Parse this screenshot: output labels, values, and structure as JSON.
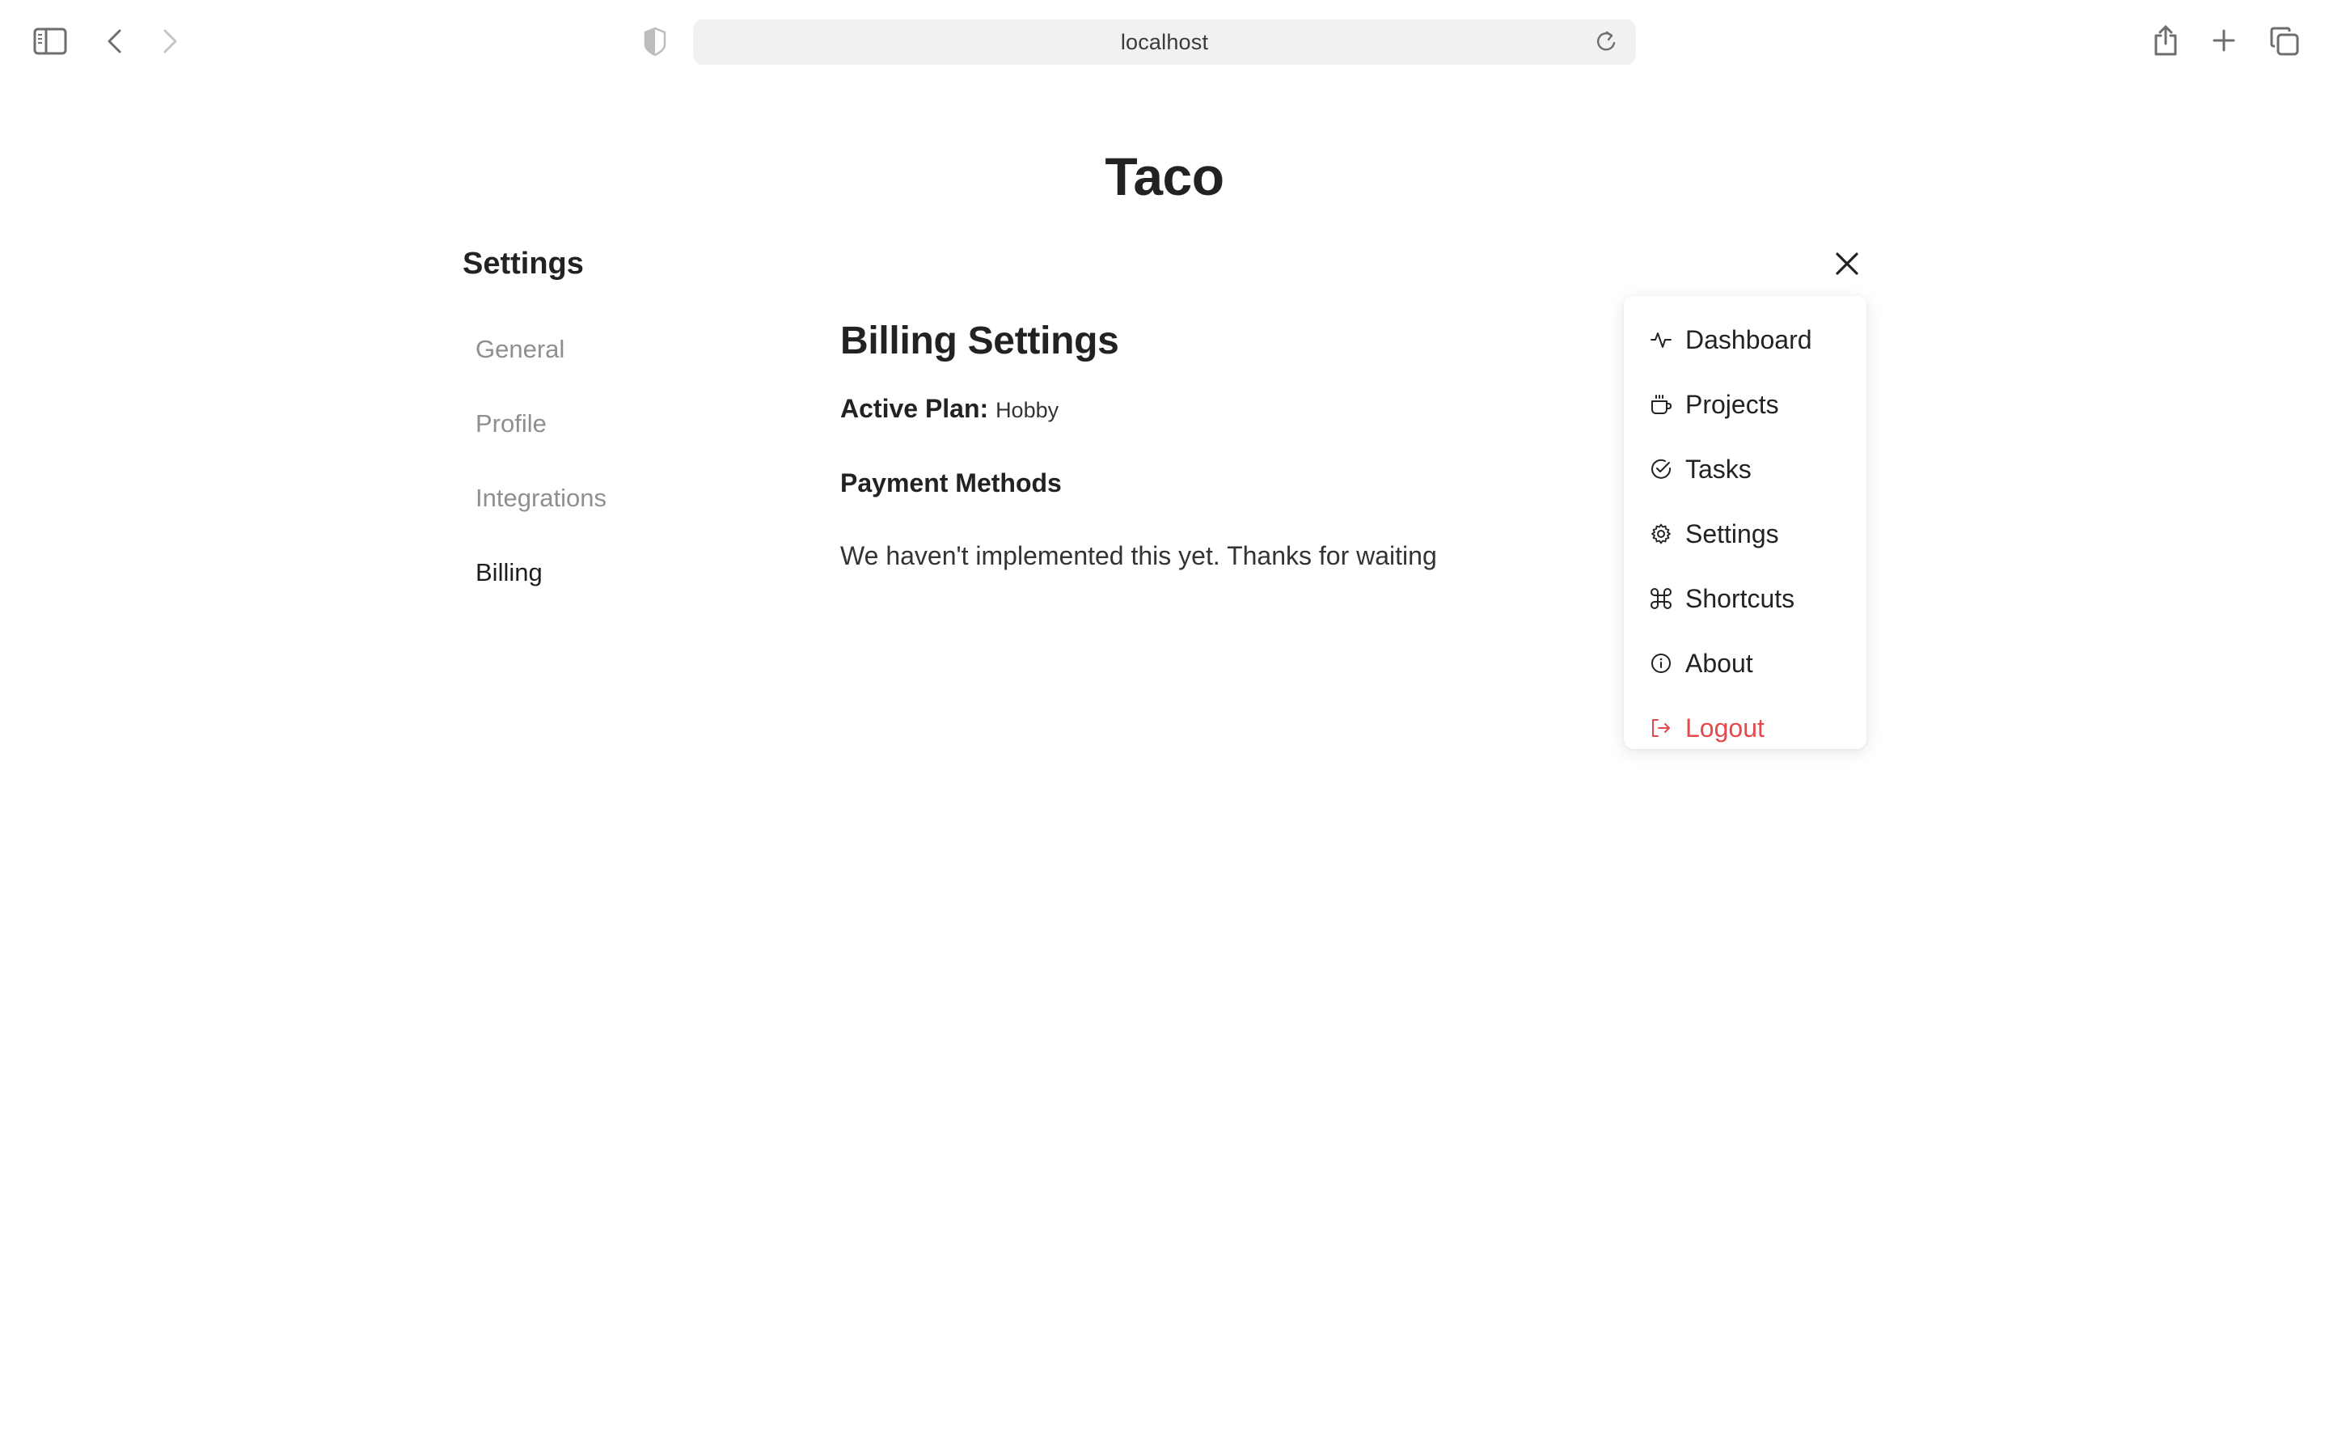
{
  "browser": {
    "url": "localhost",
    "icons": {
      "sidebar": "sidebar-icon",
      "back": "chevron-left-icon",
      "forward": "chevron-right-icon",
      "privacy": "shield-icon",
      "reload": "reload-icon",
      "share": "share-icon",
      "new_tab": "plus-icon",
      "tabs": "tabs-overview-icon"
    }
  },
  "app": {
    "title": "Taco"
  },
  "settings": {
    "heading": "Settings",
    "close_icon": "close-icon",
    "nav": [
      {
        "label": "General",
        "active": false
      },
      {
        "label": "Profile",
        "active": false
      },
      {
        "label": "Integrations",
        "active": false
      },
      {
        "label": "Billing",
        "active": true
      }
    ]
  },
  "billing": {
    "title": "Billing Settings",
    "active_plan_label": "Active Plan:",
    "active_plan_value": "Hobby",
    "payment_methods_title": "Payment Methods",
    "payment_methods_text": "We haven't implemented this yet. Thanks for waiting"
  },
  "menu": {
    "items": [
      {
        "label": "Dashboard",
        "icon": "activity-icon"
      },
      {
        "label": "Projects",
        "icon": "coffee-icon"
      },
      {
        "label": "Tasks",
        "icon": "check-circle-icon"
      },
      {
        "label": "Settings",
        "icon": "gear-icon"
      },
      {
        "label": "Shortcuts",
        "icon": "command-icon"
      },
      {
        "label": "About",
        "icon": "info-icon"
      },
      {
        "label": "Logout",
        "icon": "logout-icon",
        "danger": true
      }
    ]
  },
  "colors": {
    "text": "#222222",
    "muted": "#8f8f8f",
    "danger": "#e5484d",
    "url_bar_bg": "#f1f1f1"
  }
}
